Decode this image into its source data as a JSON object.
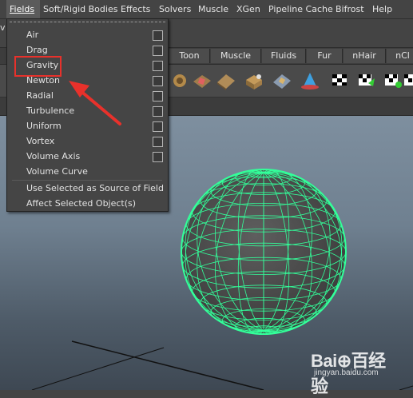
{
  "menubar": {
    "items": [
      {
        "label": "Fields",
        "active": true
      },
      {
        "label": "Soft/Rigid Bodies"
      },
      {
        "label": "Effects"
      },
      {
        "label": "Solvers"
      },
      {
        "label": "Muscle"
      },
      {
        "label": "XGen"
      },
      {
        "label": "Pipeline Cache"
      },
      {
        "label": "Bifrost"
      },
      {
        "label": "Help"
      }
    ]
  },
  "left_clip_char": "v",
  "shelf_tabs": [
    "Toon",
    "Muscle",
    "Fluids",
    "Fur",
    "nHair",
    "nCl"
  ],
  "fields_menu": {
    "items": [
      "Air",
      "Drag",
      "Gravity",
      "Newton",
      "Radial",
      "Turbulence",
      "Uniform",
      "Vortex",
      "Volume Axis",
      "Volume Curve"
    ],
    "option_box_items": [
      "Air",
      "Drag",
      "Gravity",
      "Newton",
      "Radial",
      "Turbulence",
      "Uniform",
      "Vortex",
      "Volume Axis"
    ],
    "actions": [
      "Use Selected as Source of Field",
      "Affect Selected Object(s)"
    ],
    "highlighted_item": "Gravity"
  },
  "colors": {
    "highlight_box": "#e8312b",
    "arrow": "#e8312b",
    "sphere_wire": "#33ff9a",
    "sphere_fill": "#555555"
  },
  "watermark": {
    "brand": "Bai⊕百经验",
    "url": "jingyan.baidu.com"
  }
}
